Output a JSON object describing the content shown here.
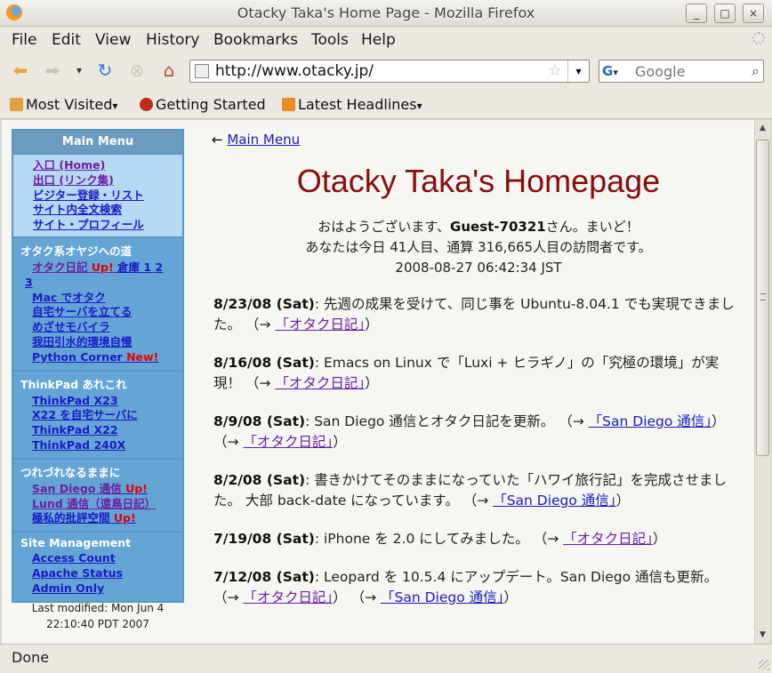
{
  "window": {
    "title": "Otacky Taka's Home Page - Mozilla Firefox",
    "min_label": "_",
    "max_label": "□",
    "close_label": "×"
  },
  "menu": [
    "File",
    "Edit",
    "View",
    "History",
    "Bookmarks",
    "Tools",
    "Help"
  ],
  "nav": {
    "url": "http://www.otacky.jp/",
    "search_placeholder": "Google",
    "search_engine": "G"
  },
  "bookmarks": {
    "most_visited": "Most Visited",
    "getting_started": "Getting Started",
    "latest_headlines": "Latest Headlines"
  },
  "sidebar": {
    "head": "Main Menu",
    "main_links": [
      "入口 (Home)",
      "出口 (リンク集)",
      "ビジター登録・リスト",
      "サイト内全文検索",
      "サイト・プロフィール"
    ],
    "sec1": {
      "title": "オタク系オヤジへの道",
      "otaku": "オタク日記",
      "up": "Up!",
      "souko": "倉庫 1",
      "two": "2",
      "three": "3",
      "links": [
        "Mac でオタク",
        "自宅サーバを立てる",
        "めざせモバイラ",
        "我田引水的環境自慢"
      ],
      "python": "Python Corner",
      "new": "New!"
    },
    "sec2": {
      "title": "ThinkPad あれこれ",
      "links": [
        "ThinkPad X23",
        "X22 を自宅サーバに",
        "ThinkPad X22",
        "ThinkPad 240X"
      ]
    },
    "sec3": {
      "title": "つれづれなるままに",
      "l1": "San Diego 通信",
      "l2": "Lund 通信（遠鳥日記）",
      "l3": "極私的批評空間",
      "up": "Up!"
    },
    "sec4": {
      "title": "Site Management",
      "links": [
        "Access Count",
        "Apache Status",
        "Admin Only"
      ]
    },
    "last_modified_1": "Last modified: Mon Jun 4",
    "last_modified_2": "22:10:40 PDT 2007"
  },
  "main": {
    "back_arrow": "←",
    "back_link": "Main Menu",
    "heading": "Otacky Taka's Homepage",
    "greet1_a": "おはようございます、",
    "greet1_user": "Guest-70321",
    "greet1_b": "さん。まいど！",
    "greet2": "あなたは今日 41人目、通算 316,665人目の訪問者です。",
    "datetime": "2008-08-27 06:42:34 JST",
    "news": [
      {
        "date": "8/23/08 (Sat)",
        "text": ": 先週の成果を受けて、同じ事を Ubuntu-8.04.1 でも実現できました。 （→ ",
        "link1": "「オタク日記」",
        "tail": "）"
      },
      {
        "date": "8/16/08 (Sat)",
        "text": ": Emacs on Linux で「Luxi + ヒラギノ」の「究極の環境」が実現！ （→ ",
        "link1": "「オタク日記」",
        "tail": "）"
      },
      {
        "date": "8/9/08 (Sat)",
        "text": ": San Diego 通信とオタク日記を更新。 （→ ",
        "link1": "「San Diego 通信」",
        "mid": "） （→ ",
        "link2": "「オタク日記」",
        "tail": "）"
      },
      {
        "date": "8/2/08 (Sat)",
        "text": ": 書きかけてそのままになっていた「ハワイ旅行記」を完成させました。 大部 back-date になっています。 （→ ",
        "link1": "「San Diego 通信」",
        "tail": "）"
      },
      {
        "date": "7/19/08 (Sat)",
        "text": ": iPhone を 2.0 にしてみました。 （→ ",
        "link1": "「オタク日記」",
        "tail": "）"
      },
      {
        "date": "7/12/08 (Sat)",
        "text": ": Leopard を 10.5.4 にアップデート。San Diego 通信も更新。 （→ ",
        "link1": "「オタク日記」",
        "mid": "） （→ ",
        "link2": "「San Diego 通信」",
        "tail": "）"
      }
    ]
  },
  "status": "Done"
}
